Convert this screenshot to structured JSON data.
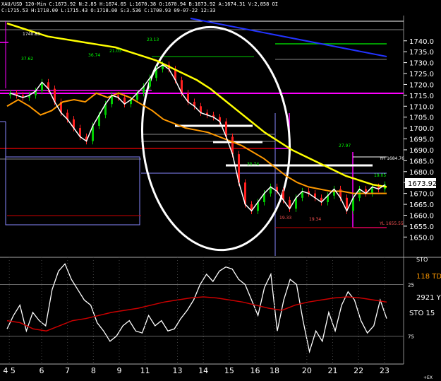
{
  "header": {
    "symbol_line": "XAU/USD 120-Min C:1673.92 N:2.85 H:1674.65 L:1670.38 O:1670.94 B:1673.92 A:1674.31 V:2,858 OI",
    "stats_line": "C:1715.53 H:1718.00 L:1715.43 O:1718.00 S:3.536 C:1700.93 09-07-22 12:33"
  },
  "colors": {
    "up_candle": "#00cc00",
    "down_candle": "#ff2020",
    "price_line": "#ffffff",
    "ma_orange": "#ff9900",
    "ma_yellow": "#ffff00",
    "trend_blue": "#2233ff",
    "level_magenta": "#ff00ff",
    "stoch_red": "#cc0000"
  },
  "last_price": "1673.92",
  "sto_tag": "STO",
  "right_labels": [
    "118 TD",
    "2921 YR",
    "STO 15"
  ],
  "corner_label": "+EX",
  "chart_data": {
    "type": "line",
    "title": "",
    "xlabel": "",
    "ylabel": "",
    "x_ticks": [
      "4 5",
      "6",
      "7",
      "8",
      "9",
      "11",
      "13",
      "14",
      "15",
      "16",
      "18",
      "20",
      "21",
      "22",
      "23"
    ],
    "x_tick_pos": [
      1,
      6,
      10,
      14,
      18,
      22,
      27,
      31,
      35,
      39,
      42,
      47,
      51,
      55,
      59
    ],
    "x_range": [
      0,
      60
    ],
    "ylim": [
      1642,
      1749
    ],
    "y_ticks": [
      1650,
      1655,
      1660,
      1665,
      1670,
      1675,
      1680,
      1685,
      1690,
      1695,
      1700,
      1705,
      1710,
      1715,
      1720,
      1725,
      1730,
      1735,
      1740
    ],
    "close_series": {
      "name": "",
      "values": [
        1716,
        1715,
        1714,
        1715,
        1717,
        1721,
        1718,
        1712,
        1707,
        1704,
        1700,
        1696,
        1694,
        1701,
        1706,
        1711,
        1715,
        1714,
        1711,
        1713,
        1716,
        1719,
        1723,
        1727,
        1729,
        1727,
        1722,
        1716,
        1712,
        1710,
        1707,
        1706,
        1705,
        1703,
        1696,
        1688,
        1675,
        1665,
        1662,
        1666,
        1670,
        1673,
        1671,
        1667,
        1663,
        1668,
        1671,
        1670,
        1668,
        1666,
        1669,
        1672,
        1668,
        1662,
        1668,
        1672,
        1670,
        1673,
        1672,
        1674
      ],
      "color": "#ffffff"
    },
    "ma_series": [
      {
        "name": "",
        "color": "#ff9900",
        "values": [
          1710,
          1713,
          1710,
          1706,
          1708,
          1712,
          1713,
          1712,
          1716,
          1714,
          1716,
          1714,
          1711,
          1708,
          1704,
          1702,
          1700,
          1699,
          1698,
          1696,
          1694,
          1692,
          1689,
          1686,
          1682,
          1678,
          1675,
          1673,
          1672,
          1671,
          1671,
          1670,
          1670,
          1670,
          1670
        ]
      },
      {
        "name": "",
        "color": "#ffff00",
        "values": [
          1748,
          1746,
          1744,
          1742,
          1741,
          1740,
          1739,
          1738,
          1737,
          1735,
          1733,
          1731,
          1728,
          1725,
          1722,
          1718,
          1713,
          1708,
          1703,
          1698,
          1694,
          1690,
          1687,
          1684,
          1681,
          1678,
          1676,
          1674,
          1673
        ]
      }
    ],
    "stochastic": {
      "ylim": [
        0,
        100
      ],
      "levels": [
        25,
        75
      ],
      "k_values": [
        32,
        45,
        55,
        30,
        48,
        40,
        35,
        70,
        88,
        95,
        80,
        70,
        60,
        55,
        38,
        30,
        20,
        25,
        35,
        40,
        30,
        28,
        45,
        35,
        40,
        30,
        32,
        42,
        50,
        60,
        75,
        85,
        78,
        88,
        92,
        90,
        80,
        75,
        60,
        45,
        72,
        85,
        30,
        60,
        80,
        75,
        40,
        10,
        30,
        20,
        48,
        30,
        55,
        68,
        60,
        40,
        28,
        35,
        60,
        42
      ],
      "d_values": [
        40,
        38,
        32,
        30,
        35,
        40,
        42,
        45,
        48,
        50,
        52,
        55,
        58,
        60,
        62,
        63,
        62,
        60,
        58,
        55,
        52,
        50,
        55,
        58,
        60,
        62,
        63,
        62,
        60,
        58
      ],
      "k_color": "#ffffff",
      "d_color": "#cc0000"
    },
    "annotations": [
      "1740.83",
      "37.62",
      "36.74",
      "21.03",
      "23.13",
      "35.74",
      "27.97",
      "19.33",
      "19.34",
      "19.05",
      "YH 1684.76",
      "YL 1655.55"
    ]
  }
}
